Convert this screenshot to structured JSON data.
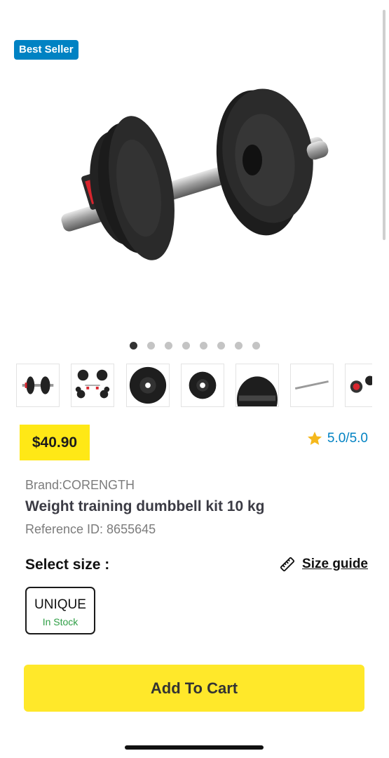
{
  "badge": {
    "label": "Best Seller",
    "color": "#0082c3"
  },
  "gallery": {
    "image": "dumbbell-kit-image",
    "dot_count": 8,
    "active_index": 0,
    "thumbnails": [
      "dumbbell-assembled",
      "plates-set",
      "large-plate",
      "small-plate",
      "plate-closeup",
      "bar",
      "collar"
    ]
  },
  "price": {
    "label": "$40.90",
    "highlight_color": "#ffe816"
  },
  "rating": {
    "icon": "star-icon",
    "value": "5.0/5.0"
  },
  "product": {
    "brand": "Brand:CORENGTH",
    "title": "Weight training dumbbell kit 10 kg",
    "reference": "Reference ID: 8655645"
  },
  "size": {
    "label": "Select size :",
    "guide_label": "Size guide",
    "guide_icon": "ruler-icon",
    "options": [
      {
        "name": "UNIQUE",
        "stock": "In Stock",
        "selected": true
      }
    ]
  },
  "cart": {
    "label": "Add To Cart",
    "color": "#ffe82a"
  }
}
